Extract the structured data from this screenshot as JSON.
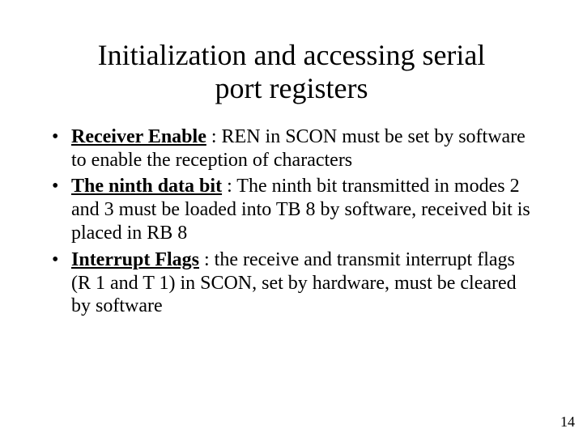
{
  "title_line1": "Initialization and accessing serial",
  "title_line2": "port registers",
  "bullets": [
    {
      "term": "Receiver Enable",
      "rest": " : REN in SCON must be set by software to enable the reception of characters"
    },
    {
      "term": "The ninth data bit",
      "rest": " : The ninth bit transmitted in modes 2 and 3 must be loaded into TB 8 by software, received bit is placed in RB 8"
    },
    {
      "term": "Interrupt Flags",
      "rest": " : the receive and transmit interrupt flags (R 1 and T 1) in SCON, set by hardware, must be cleared by software"
    }
  ],
  "page_number": "14"
}
